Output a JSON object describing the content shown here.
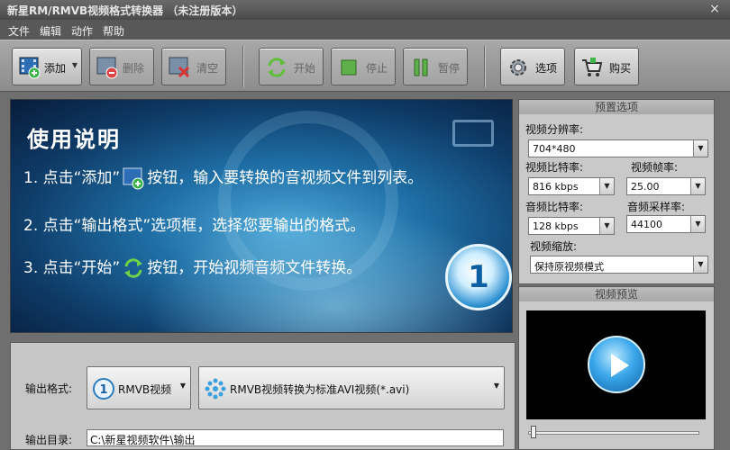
{
  "window": {
    "title": "新星RM/RMVB视频格式转换器 （未注册版本）",
    "close_glyph": "×"
  },
  "menu": [
    "文件",
    "编辑",
    "动作",
    "帮助"
  ],
  "toolbar": {
    "add_label": "添加",
    "delete_label": "删除",
    "clear_label": "清空",
    "start_label": "开始",
    "stop_label": "停止",
    "pause_label": "暂停",
    "options_label": "选项",
    "buy_label": "购买"
  },
  "instructions": {
    "heading": "使用说明",
    "line1_a": "1. 点击“添加”",
    "line1_b": "按钮，输入要转换的音视频文件到列表。",
    "line2": "2. 点击“输出格式”选项框，选择您要输出的格式。",
    "line3_a": "3. 点击“开始”",
    "line3_b": "按钮，开始视频音频文件转换。",
    "badge_number": "1"
  },
  "presets": {
    "header": "预置选项",
    "video_resolution_label": "视频分辨率:",
    "video_resolution_value": "704*480",
    "video_bitrate_label": "视频比特率:",
    "video_bitrate_value": "816 kbps",
    "video_fps_label": "视频帧率:",
    "video_fps_value": "25.00",
    "audio_bitrate_label": "音频比特率:",
    "audio_bitrate_value": "128 kbps",
    "audio_samplerate_label": "音频采样率:",
    "audio_samplerate_value": "44100",
    "video_scale_label": "视频缩放:",
    "video_scale_value": "保持原视频模式"
  },
  "preview": {
    "header": "视频预览",
    "seek_position": 0.0
  },
  "output": {
    "format_label": "输出格式:",
    "format_category": "RMVB视频",
    "format_detail": "RMVB视频转换为标准AVI视频(*.avi)",
    "dir_label": "输出目录:",
    "dir_value": "C:\\新星视频软件\\输出"
  },
  "colors": {
    "accent_blue": "#1f6fa6",
    "toolbar_bg": "#9c9c9c",
    "panel_bg": "#c9c9c9"
  },
  "icons": {
    "add": "film-add-icon",
    "delete": "film-delete-icon",
    "clear": "film-clear-icon",
    "start": "refresh-arrows-icon",
    "stop": "stop-icon",
    "pause": "pause-icon",
    "options": "gear-icon",
    "buy": "shopping-cart-icon",
    "play": "play-icon"
  }
}
